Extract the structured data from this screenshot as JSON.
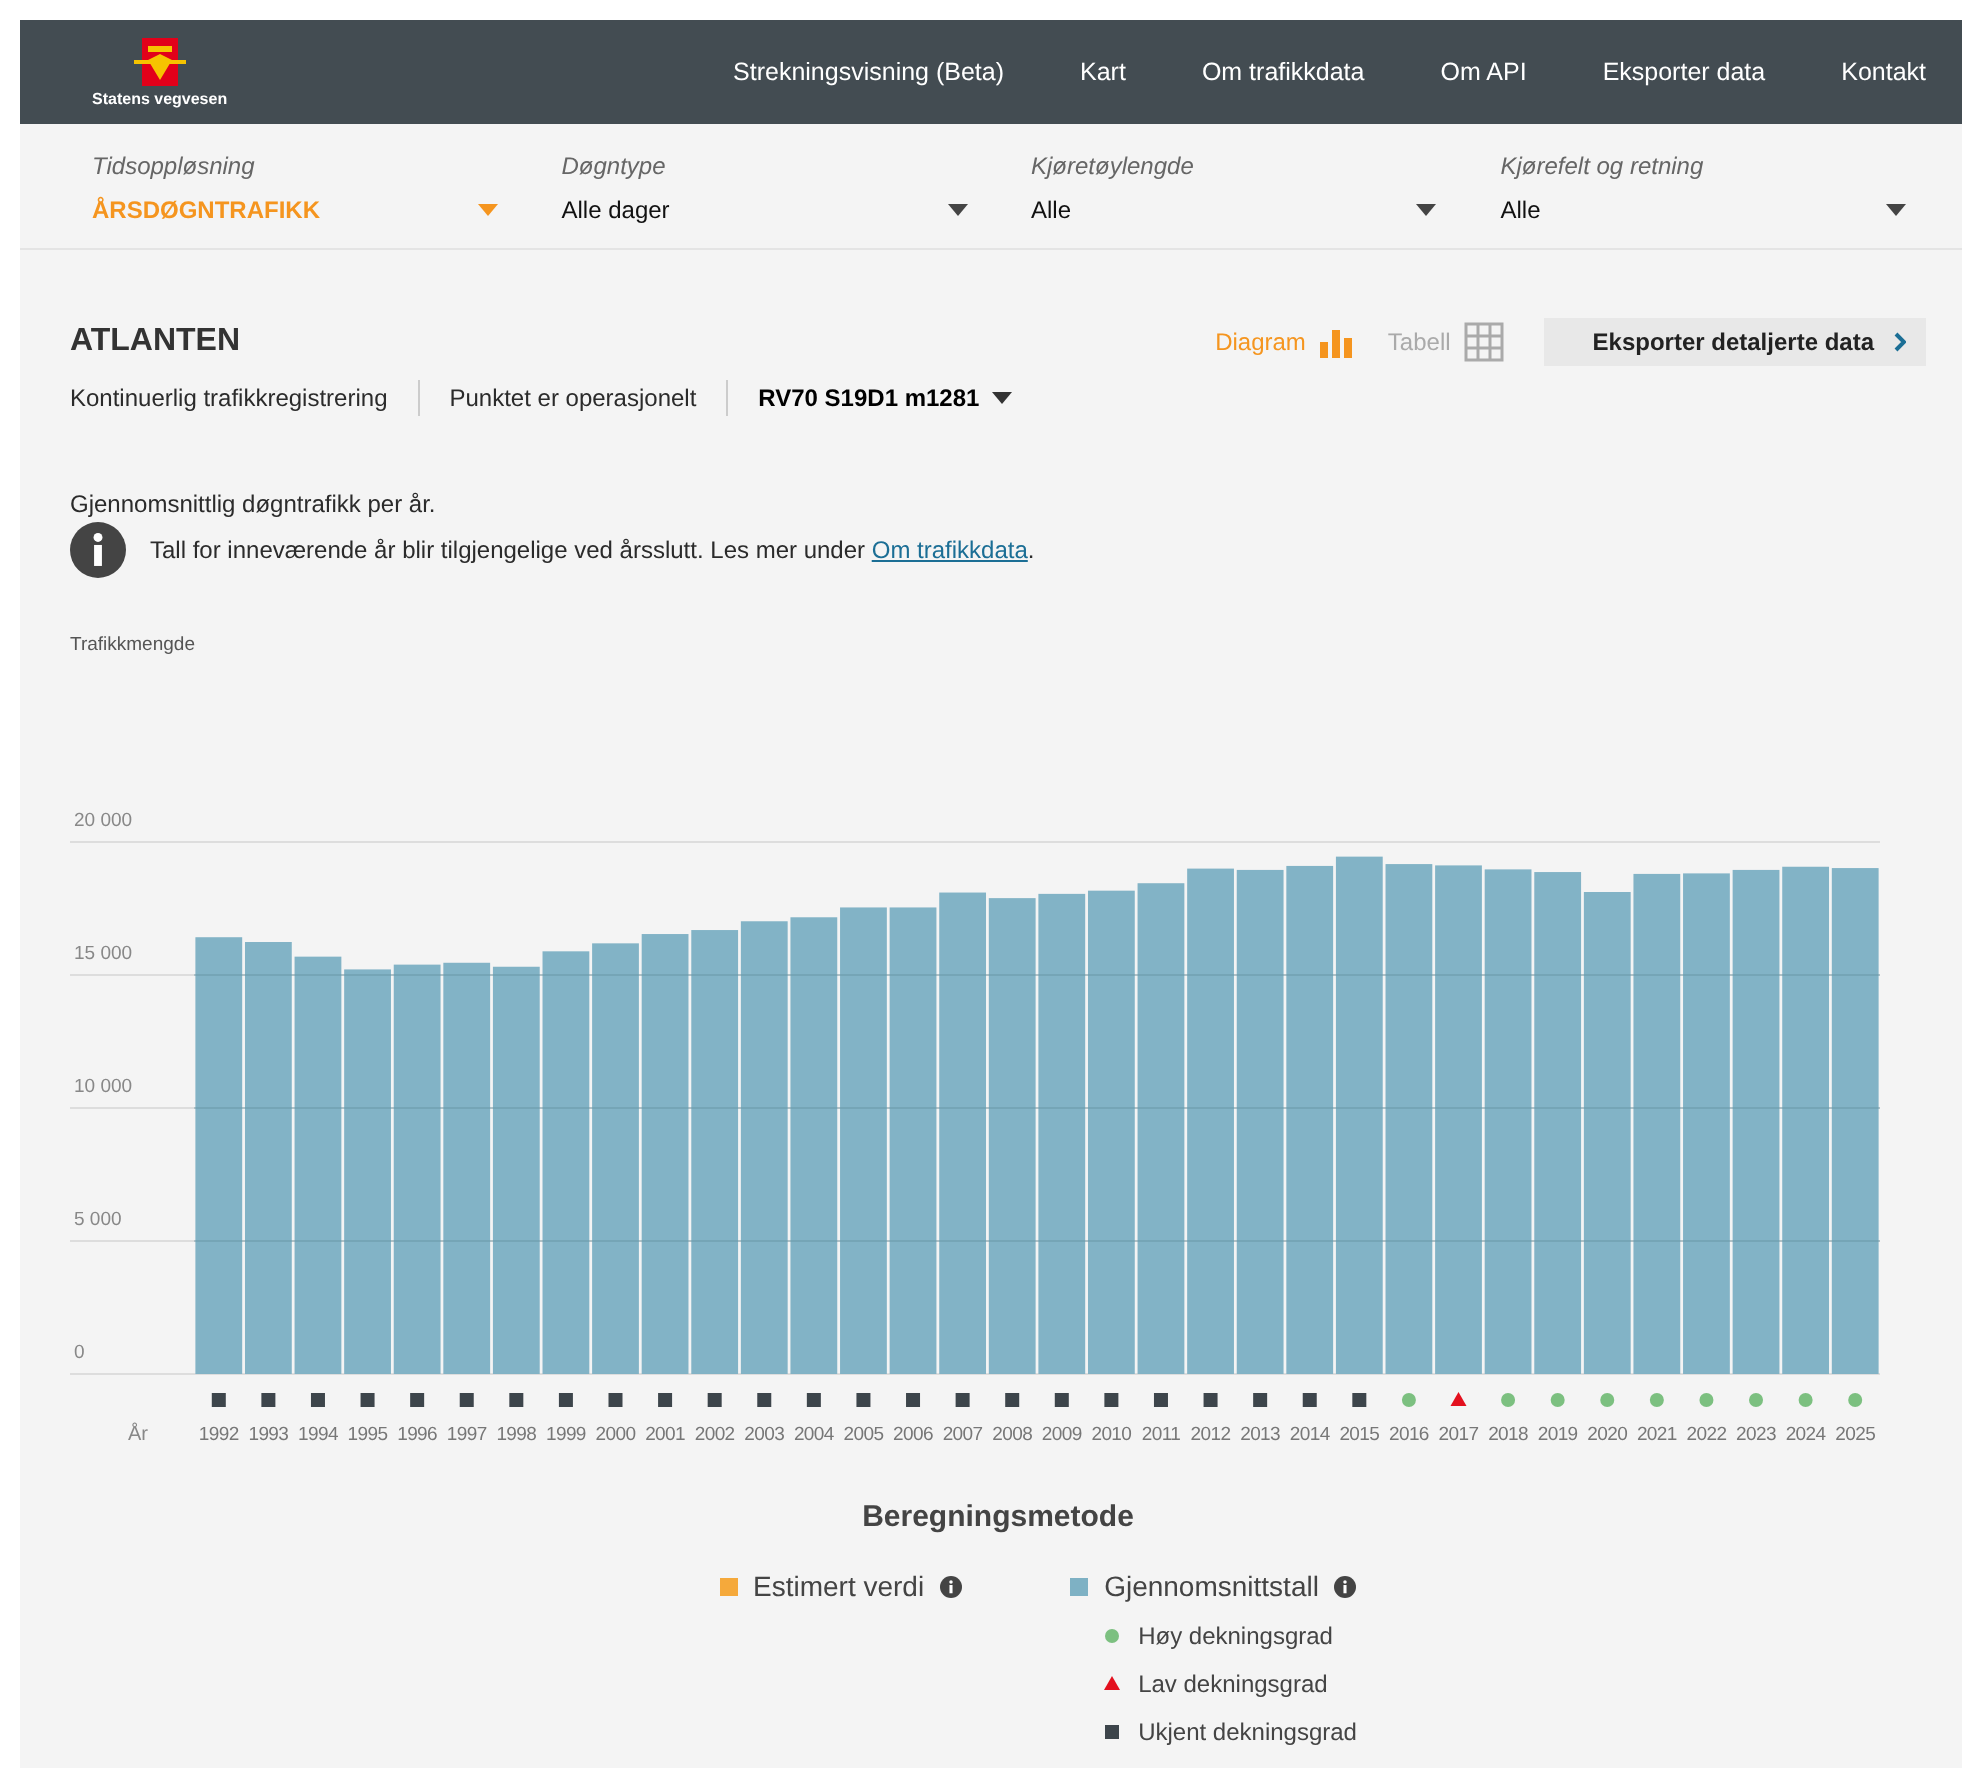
{
  "header": {
    "brand": "Statens vegvesen",
    "nav": [
      "Strekningsvisning (Beta)",
      "Kart",
      "Om trafikkdata",
      "Om API",
      "Eksporter data",
      "Kontakt"
    ]
  },
  "filters": [
    {
      "label": "Tidsoppløsning",
      "value": "ÅRSDØGNTRAFIKK",
      "highlighted": true
    },
    {
      "label": "Døgntype",
      "value": "Alle dager",
      "highlighted": false
    },
    {
      "label": "Kjøretøylengde",
      "value": "Alle",
      "highlighted": false
    },
    {
      "label": "Kjørefelt og retning",
      "value": "Alle",
      "highlighted": false
    }
  ],
  "station": {
    "title": "ATLANTEN",
    "meta": [
      "Kontinuerlig trafikkregistrering",
      "Punktet er operasjonelt"
    ],
    "point": "RV70 S19D1 m1281"
  },
  "views": [
    {
      "label": "Diagram",
      "kind": "chart",
      "selected": true
    },
    {
      "label": "Tabell",
      "kind": "table",
      "selected": false
    }
  ],
  "export_button": "Eksporter detaljerte data",
  "description": "Gjennomsnittlig døgntrafikk per år.",
  "notice": {
    "text": "Tall for inneværende år blir tilgjengelige ved årsslutt. Les mer under ",
    "link": "Om trafikkdata",
    "after": "."
  },
  "chart": {
    "xaxis_label": "År",
    "chart_data": {
      "type": "bar",
      "ylabel": "Trafikkmengde",
      "categories": [
        "1992",
        "1993",
        "1994",
        "1995",
        "1996",
        "1997",
        "1998",
        "1999",
        "2000",
        "2001",
        "2002",
        "2003",
        "2004",
        "2005",
        "2006",
        "2007",
        "2008",
        "2009",
        "2010",
        "2011",
        "2012",
        "2013",
        "2014",
        "2015",
        "2016",
        "2017",
        "2018",
        "2019",
        "2020",
        "2021",
        "2022",
        "2023",
        "2024",
        "2025"
      ],
      "grid": true,
      "series": [
        {
          "color": "#7eb1c4",
          "values": [
            16420,
            16240,
            15690,
            15210,
            15390,
            15460,
            15310,
            15890,
            16190,
            16540,
            16690,
            17020,
            17170,
            17540,
            17540,
            18100,
            17890,
            18050,
            18170,
            18450,
            19000,
            18950,
            19100,
            19450,
            19170,
            19120,
            18970,
            18870,
            18120,
            18800,
            18820,
            18950,
            19070,
            19020
          ]
        }
      ],
      "ylim": [
        0,
        20000
      ],
      "yticks": [
        {
          "value": 0,
          "label": "0"
        },
        {
          "value": 5000,
          "label": "5 000"
        },
        {
          "value": 10000,
          "label": "10 000"
        },
        {
          "value": 15000,
          "label": "15 000"
        },
        {
          "value": 20000,
          "label": "20 000"
        }
      ]
    },
    "coverage": [
      {
        "kind": "unknown"
      },
      {
        "kind": "unknown"
      },
      {
        "kind": "unknown"
      },
      {
        "kind": "unknown"
      },
      {
        "kind": "unknown"
      },
      {
        "kind": "unknown"
      },
      {
        "kind": "unknown"
      },
      {
        "kind": "unknown"
      },
      {
        "kind": "unknown"
      },
      {
        "kind": "unknown"
      },
      {
        "kind": "unknown"
      },
      {
        "kind": "unknown"
      },
      {
        "kind": "unknown"
      },
      {
        "kind": "unknown"
      },
      {
        "kind": "unknown"
      },
      {
        "kind": "unknown"
      },
      {
        "kind": "unknown"
      },
      {
        "kind": "unknown"
      },
      {
        "kind": "unknown"
      },
      {
        "kind": "unknown"
      },
      {
        "kind": "unknown"
      },
      {
        "kind": "unknown"
      },
      {
        "kind": "unknown"
      },
      {
        "kind": "unknown"
      },
      {
        "kind": "high"
      },
      {
        "kind": "low"
      },
      {
        "kind": "high"
      },
      {
        "kind": "high"
      },
      {
        "kind": "high"
      },
      {
        "kind": "high"
      },
      {
        "kind": "high"
      },
      {
        "kind": "high"
      },
      {
        "kind": "high"
      },
      {
        "kind": "high"
      }
    ]
  },
  "legend": {
    "title": "Beregningsmetode",
    "methods": [
      {
        "label": "Estimert verdi",
        "color": "#f5a93b"
      },
      {
        "label": "Gjennomsnittstall",
        "color": "#7eb1c4"
      }
    ],
    "coverage": [
      {
        "kind": "high",
        "label": "Høy dekningsgrad",
        "color": "#7cc080"
      },
      {
        "kind": "low",
        "label": "Lav dekningsgrad",
        "color": "#e3101e"
      },
      {
        "kind": "unknown",
        "label": "Ukjent dekningsgrad",
        "color": "#3d454b"
      }
    ]
  }
}
